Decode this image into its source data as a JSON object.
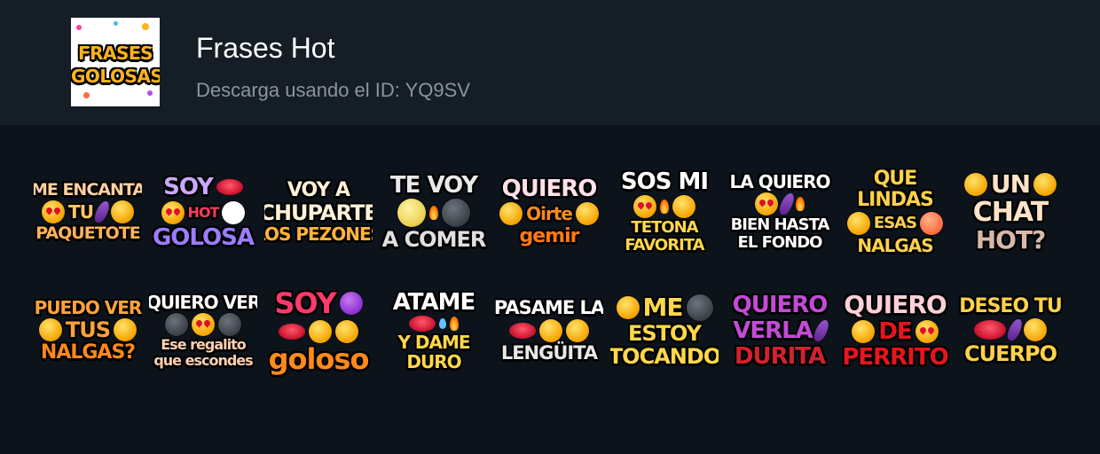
{
  "pack": {
    "title": "Frases Hot",
    "subtitle": "Descarga usando el ID: YQ9SV",
    "icon_text": [
      "FRASES",
      "GOLOSAS"
    ]
  },
  "colors": {
    "background": "#0d131b",
    "header_background": "#151d26",
    "title": "#ffffff",
    "subtitle": "#8b949c"
  },
  "stickers": [
    {
      "lines": [
        "ME ENCANTA",
        "TU",
        "PAQUETOTE"
      ]
    },
    {
      "lines": [
        "SOY",
        "HOT",
        "GOLOSA"
      ]
    },
    {
      "lines": [
        "VOY A",
        "CHUPARTE",
        "LOS PEZONES"
      ]
    },
    {
      "lines": [
        "TE VOY",
        "A COMER"
      ]
    },
    {
      "lines": [
        "QUIERO",
        "Oirte",
        "gemir"
      ]
    },
    {
      "lines": [
        "SOS MI",
        "TETONA",
        "FAVORITA"
      ]
    },
    {
      "lines": [
        "LA QUIERO",
        "BIEN HASTA",
        "EL FONDO"
      ]
    },
    {
      "lines": [
        "QUE",
        "LINDAS",
        "ESAS",
        "NALGAS"
      ]
    },
    {
      "lines": [
        "UN",
        "CHAT",
        "HOT?"
      ]
    },
    {
      "lines": [
        "PUEDO VER",
        "TUS",
        "NALGAS?"
      ]
    },
    {
      "lines": [
        "QUIERO VER",
        "Ese regalito",
        "que escondes"
      ]
    },
    {
      "lines": [
        "SOY",
        "goloso"
      ]
    },
    {
      "lines": [
        "ATAME",
        "Y DAME",
        "DURO"
      ]
    },
    {
      "lines": [
        "PASAME LA",
        "LENGÜITA"
      ]
    },
    {
      "lines": [
        "ME",
        "ESTOY",
        "TOCANDO"
      ]
    },
    {
      "lines": [
        "QUIERO",
        "VERLA",
        "DURITA"
      ]
    },
    {
      "lines": [
        "QUIERO",
        "DE",
        "PERRITO"
      ]
    },
    {
      "lines": [
        "DESEO TU",
        "CUERPO"
      ]
    }
  ]
}
